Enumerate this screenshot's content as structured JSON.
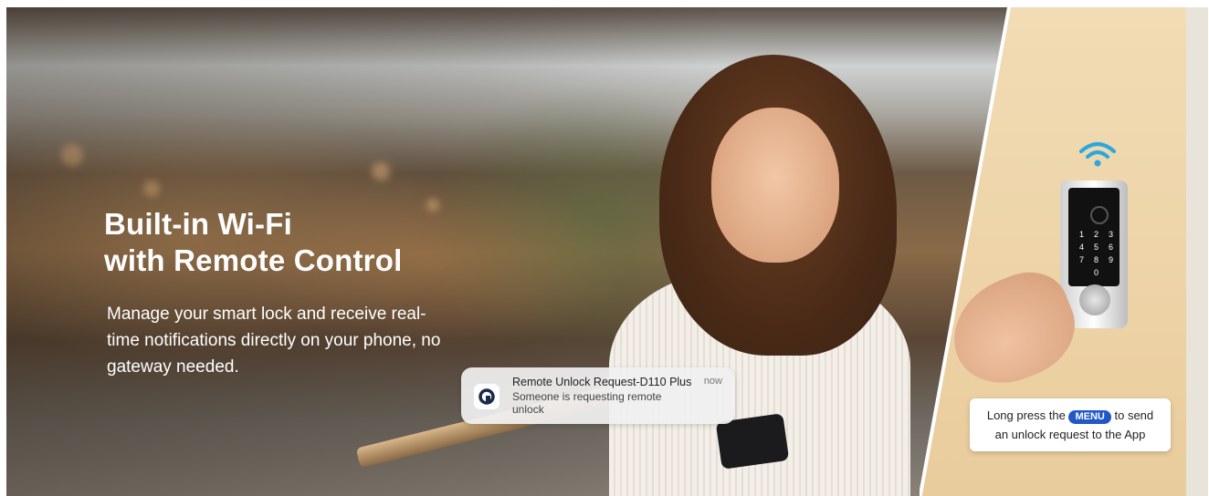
{
  "headline": {
    "line1": "Built-in Wi-Fi",
    "line2": "with Remote Control"
  },
  "description": "Manage your smart lock and receive real-time notifications directly on your phone, no gateway needed.",
  "notification": {
    "title": "Remote Unlock Request-D110 Plus",
    "time": "now",
    "body": "Someone is requesting remote unlock",
    "icon": "app-logo-icon"
  },
  "tooltip": {
    "prefix": "Long press the",
    "key": "MENU",
    "suffix": "to send",
    "line2": "an unlock request to the App"
  },
  "lock": {
    "keypad": [
      "1",
      "2",
      "3",
      "4",
      "5",
      "6",
      "7",
      "8",
      "9",
      "0"
    ]
  },
  "colors": {
    "accent": "#2157c7",
    "wifi": "#2aa8e0",
    "text": "#ffffff"
  }
}
